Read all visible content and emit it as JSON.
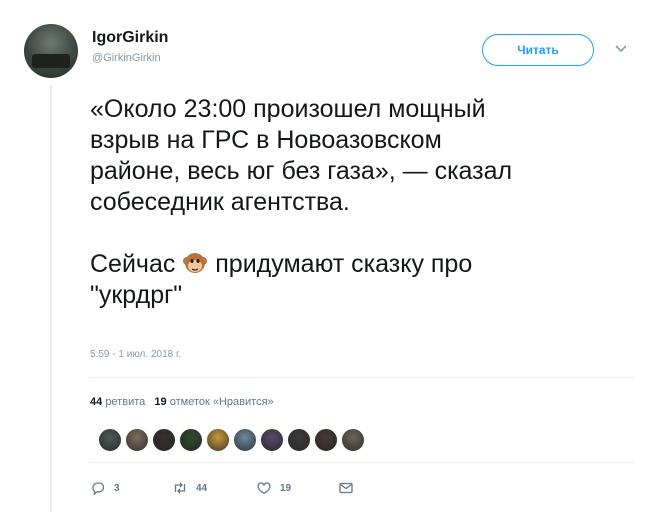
{
  "author": {
    "name": "IgorGirkin",
    "handle": "@GirkinGirkin",
    "follow_label": "Читать"
  },
  "tweet": {
    "text_part1": "«Около 23:00 произошел мощный\nвзрыв на ГРС в Новоазовском\nрайоне, весь юг без газа», — сказал\nсобеседник агентства.\n\nСейчас ",
    "text_part2": " придумают сказку про\n\"укрдрг\"",
    "emoji_icon": "monkey-face-emoji",
    "timestamp": "5:59 - 1 июл. 2018 г."
  },
  "stats": {
    "retweets_count": "44",
    "retweets_label": "ретвита",
    "likes_count": "19",
    "likes_label": "отметок «Нравится»"
  },
  "likers": [
    {
      "color": "#4e5a58"
    },
    {
      "color": "#7a7060"
    },
    {
      "color": "#3a3030"
    },
    {
      "color": "#2f4a2c"
    },
    {
      "color": "#c89a3a"
    },
    {
      "color": "#6a8aa0"
    },
    {
      "color": "#5a4a6a"
    },
    {
      "color": "#3c3c3c"
    },
    {
      "color": "#4a3a34"
    },
    {
      "color": "#6e6658"
    }
  ],
  "actions": {
    "reply_count": "3",
    "retweet_count": "44",
    "like_count": "19"
  },
  "colors": {
    "accent": "#1da1f2",
    "text": "#14171a",
    "muted": "#8899a6"
  }
}
